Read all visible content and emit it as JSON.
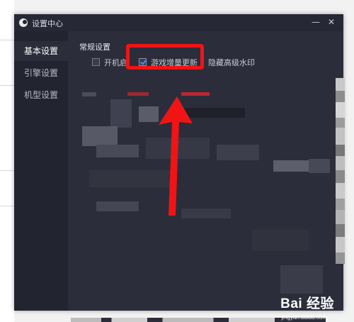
{
  "window": {
    "title": "设置中心"
  },
  "sidebar": {
    "items": [
      {
        "label": "基本设置",
        "active": true
      },
      {
        "label": "引擎设置",
        "active": false
      },
      {
        "label": "机型设置",
        "active": false
      }
    ]
  },
  "content": {
    "section_title": "常规设置",
    "options": [
      {
        "label": "开机启",
        "checked": false
      },
      {
        "label": "游戏增量更新",
        "checked": true
      },
      {
        "label": "隐藏高级水印",
        "checked": false
      }
    ]
  },
  "annotation": {
    "color": "#f01414"
  },
  "watermark": {
    "brand": "Bai 经验",
    "url": "jingyan.baidu.com"
  },
  "colors": {
    "window_bg": "#2b2d3b",
    "sidebar_bg": "#22242f",
    "check_accent": "#4a8cff"
  }
}
